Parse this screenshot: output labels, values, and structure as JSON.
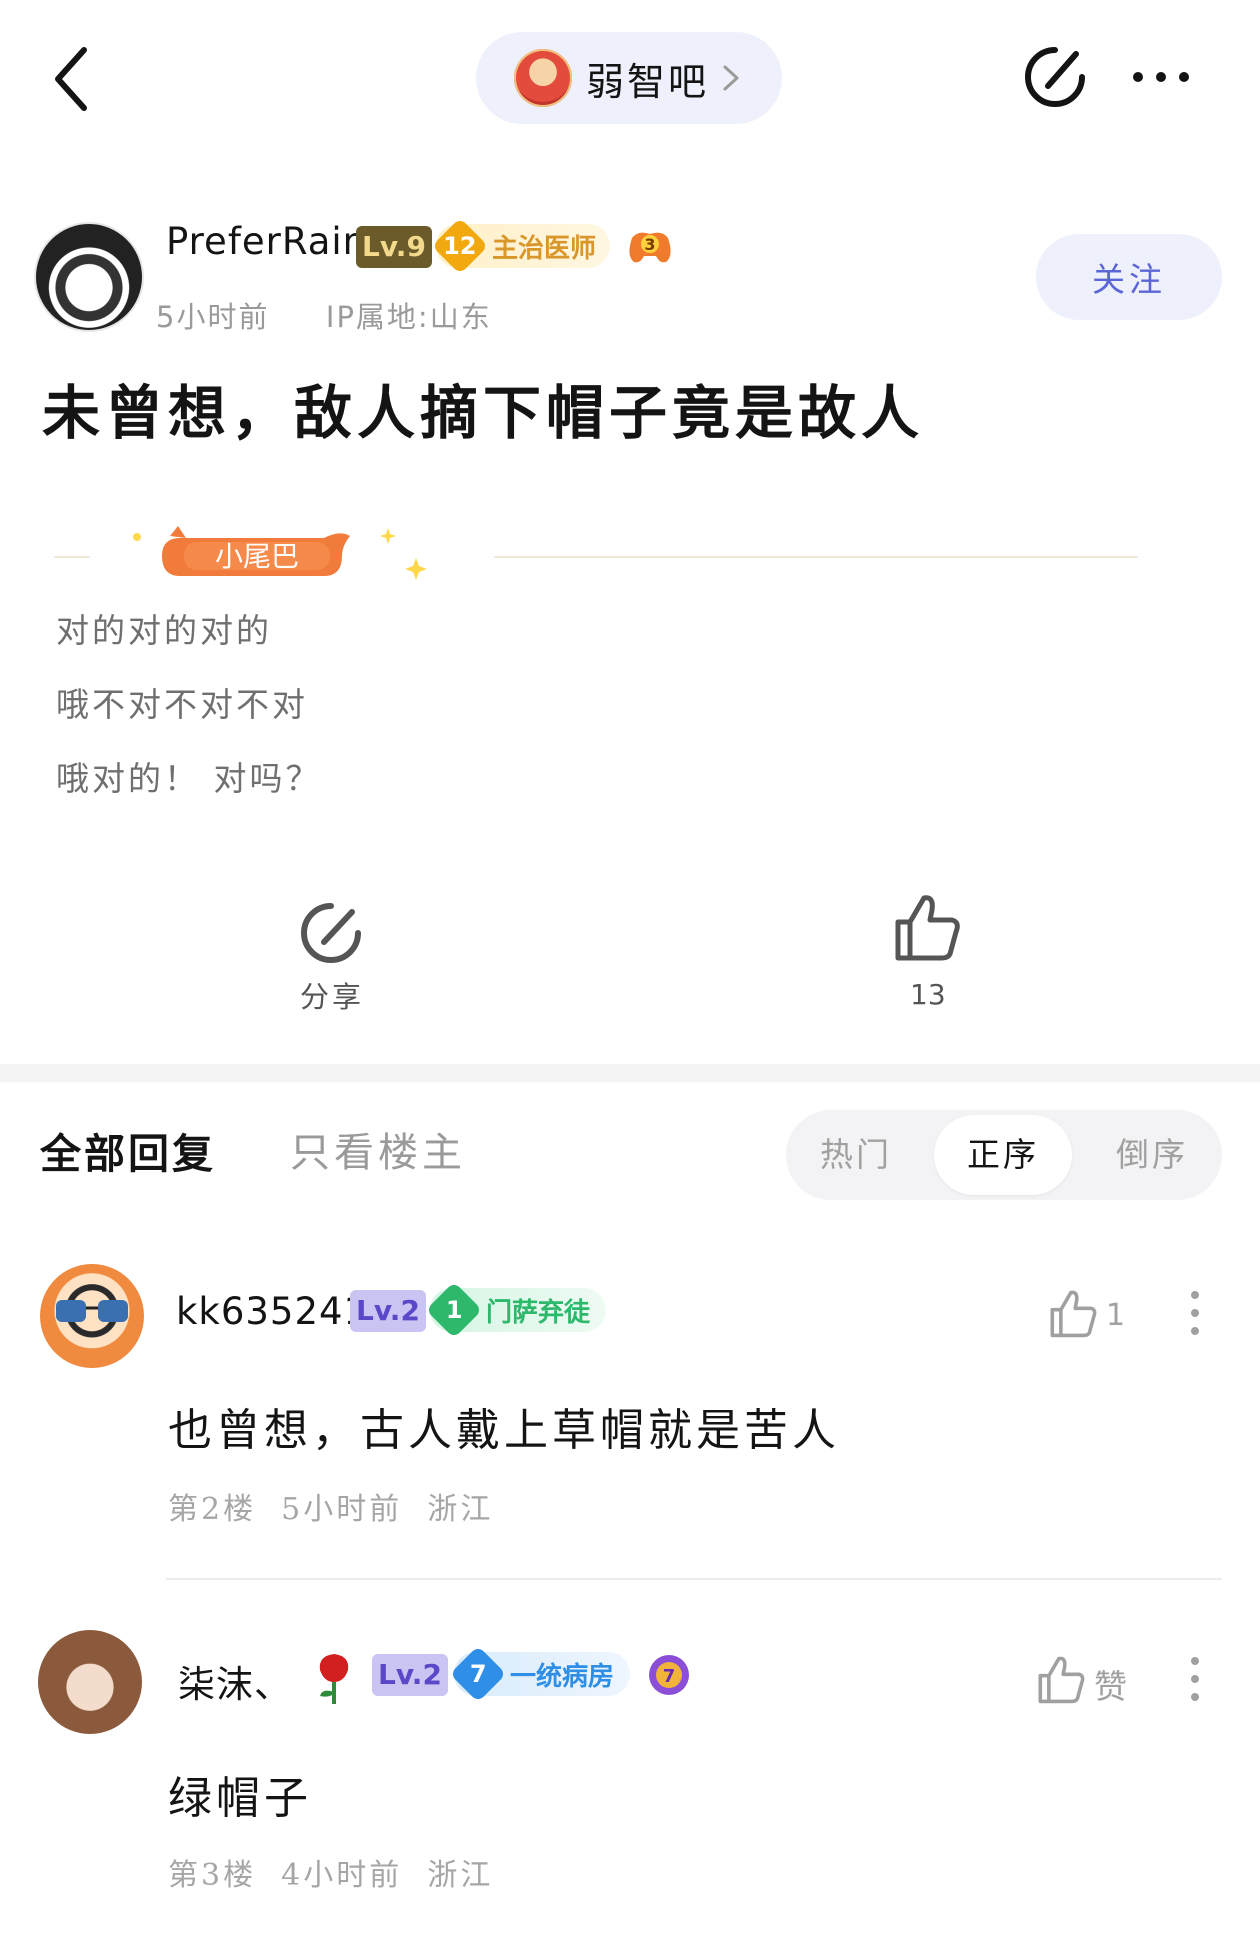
{
  "top_bar": {
    "forum_name": "弱智吧",
    "icons": [
      "back-arrow-icon",
      "chevron-right-icon",
      "share-icon",
      "more-icon"
    ]
  },
  "post": {
    "author": {
      "name": "PreferRain",
      "level": "Lv.9",
      "title_level": "12",
      "title": "主治医师",
      "badge_count": "3",
      "time": "5小时前",
      "ip": "IP属地:山东"
    },
    "follow_label": "关注",
    "title": "未曾想，敌人摘下帽子竟是故人",
    "tail_label": "小尾巴",
    "tail_lines": [
      "对的对的对的",
      "哦不对不对不对",
      "哦对的！ 对吗？"
    ],
    "share_label": "分享",
    "like_count": "13"
  },
  "replies_header": {
    "tab_all": "全部回复",
    "tab_op": "只看楼主",
    "sort_options": [
      "热门",
      "正序",
      "倒序"
    ],
    "selected_sort": "正序"
  },
  "comments": [
    {
      "name": "kk635241",
      "level": "Lv.2",
      "title_level": "1",
      "title": "门萨弃徒",
      "text": "也曾想，古人戴上草帽就是苦人",
      "meta": "第2楼  5小时前  浙江",
      "likes": "1"
    },
    {
      "name": "柒沫、",
      "level": "Lv.2",
      "title_level": "7",
      "title": "一统病房",
      "badge_count": "7",
      "text": "绿帽子",
      "meta": "第3楼  4小时前  浙江",
      "likes": "赞"
    }
  ],
  "colors": {
    "accent": "#5b66d6",
    "pill_bg": "#eef0fb",
    "gold_tag": "#f2a90f",
    "green_tag": "#2db86b",
    "blue_tag": "#2f8ee6"
  }
}
